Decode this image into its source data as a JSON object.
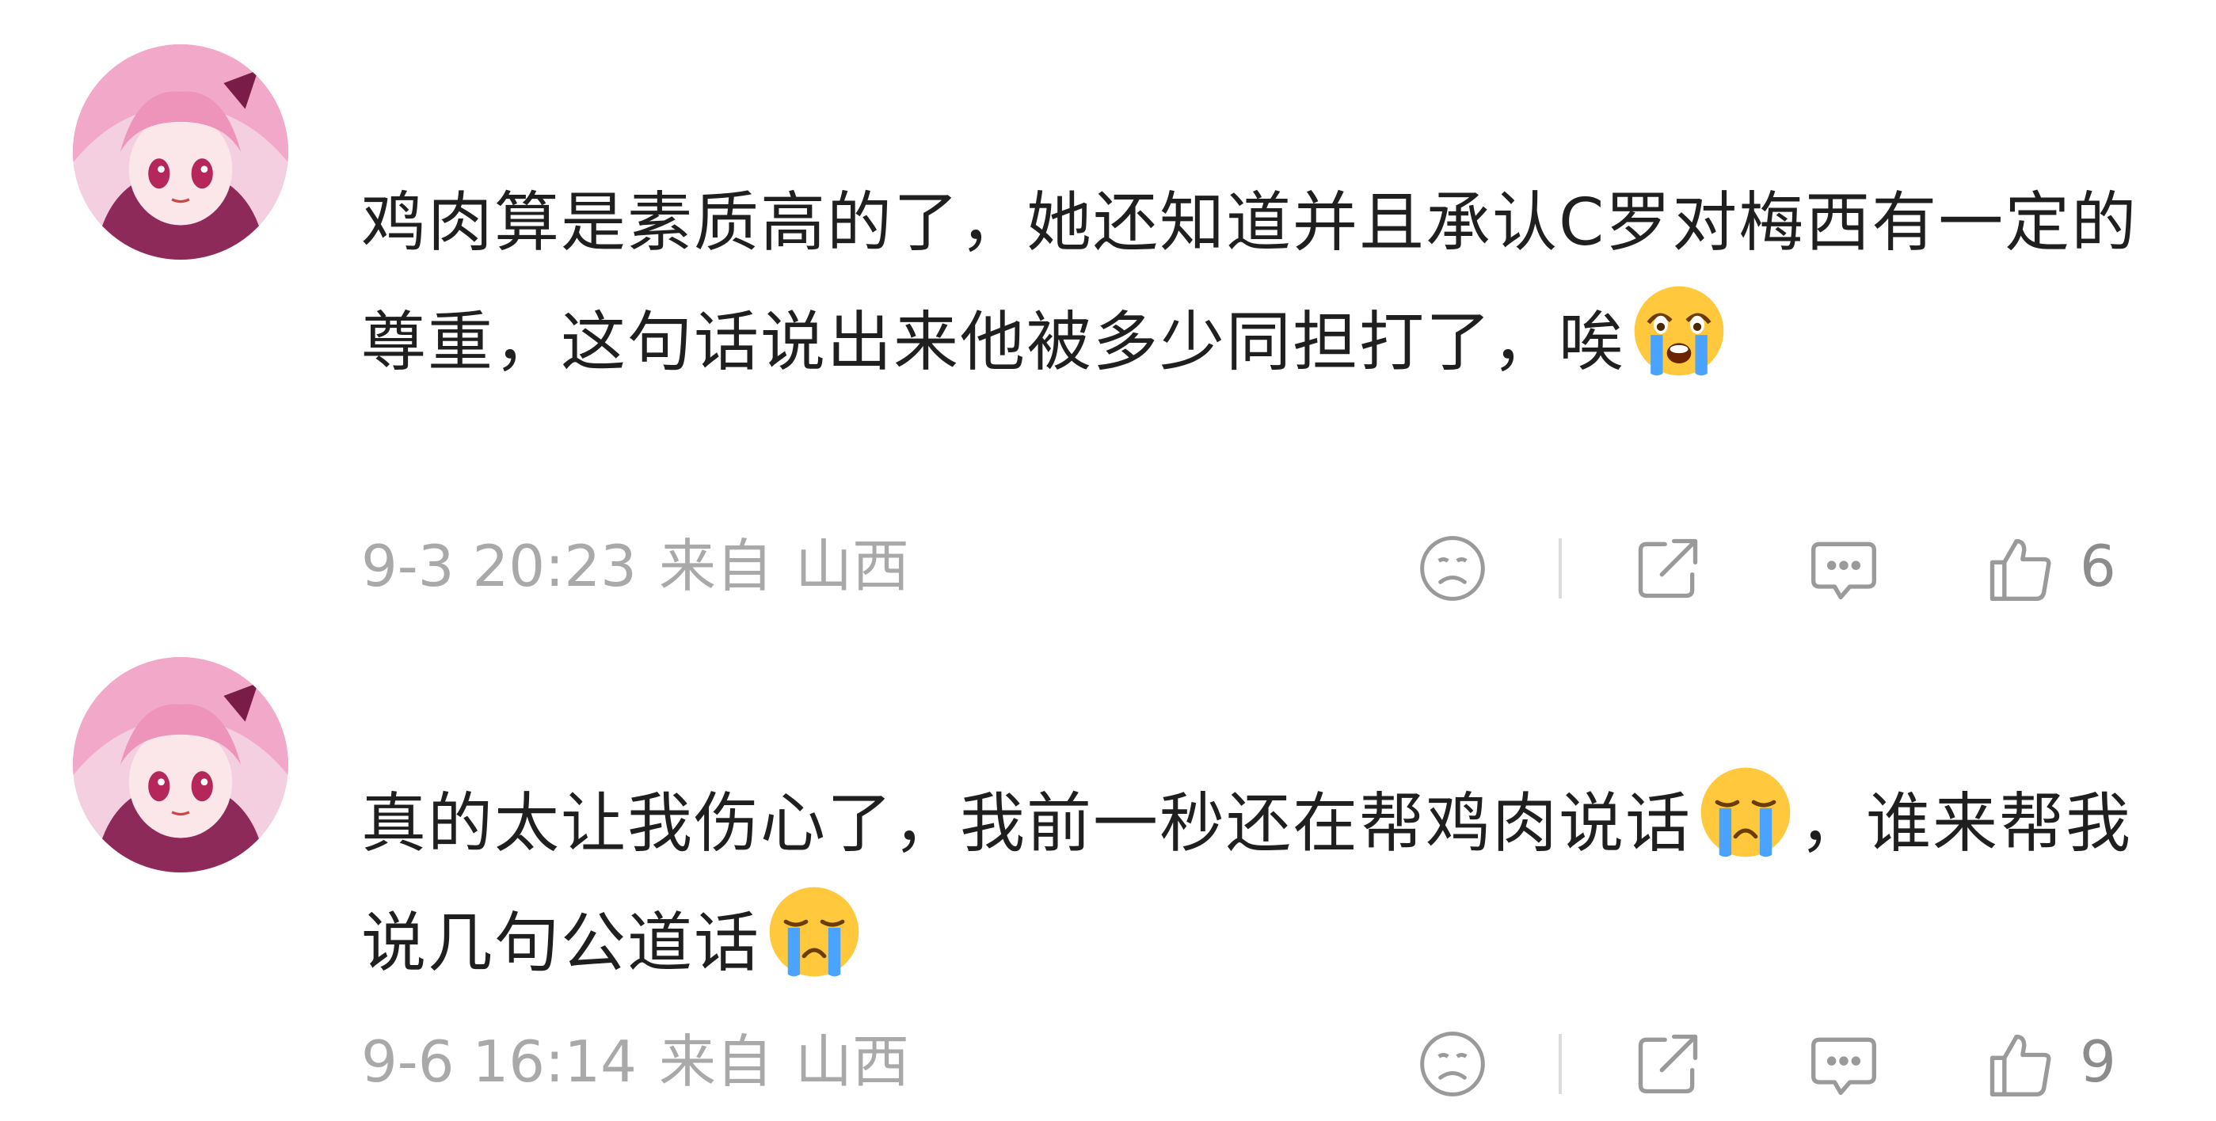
{
  "comments": [
    {
      "text_line1": "鸡肉算是素质高的了，她还知道并且承认C罗对梅西有一定的尊重，这句话说出来他被多少同担打了，唉",
      "emoji_after_text": "crying-emoji",
      "date": "9-3 20:23",
      "location_prefix": "来自",
      "location": "山西",
      "like_count": "6"
    },
    {
      "text_part1": "真的太让我伤心了，我前一秒还在帮鸡肉说话",
      "emoji_mid": "crying-emoji",
      "text_part2": "，谁来帮我说几句公道话",
      "emoji_end": "crying-emoji",
      "date": "9-6 16:14",
      "location_prefix": "来自",
      "location": "山西",
      "like_count": "9"
    }
  ],
  "icons": {
    "dislike": "frown-face-icon",
    "share": "share-icon",
    "comment": "comment-bubble-icon",
    "like": "thumbs-up-icon"
  },
  "colors": {
    "text": "#1f1f1f",
    "meta": "#a9a9a9",
    "icon": "#9a9a9a",
    "emoji_face": "#ffc83d",
    "emoji_tears": "#4aa3ff"
  }
}
